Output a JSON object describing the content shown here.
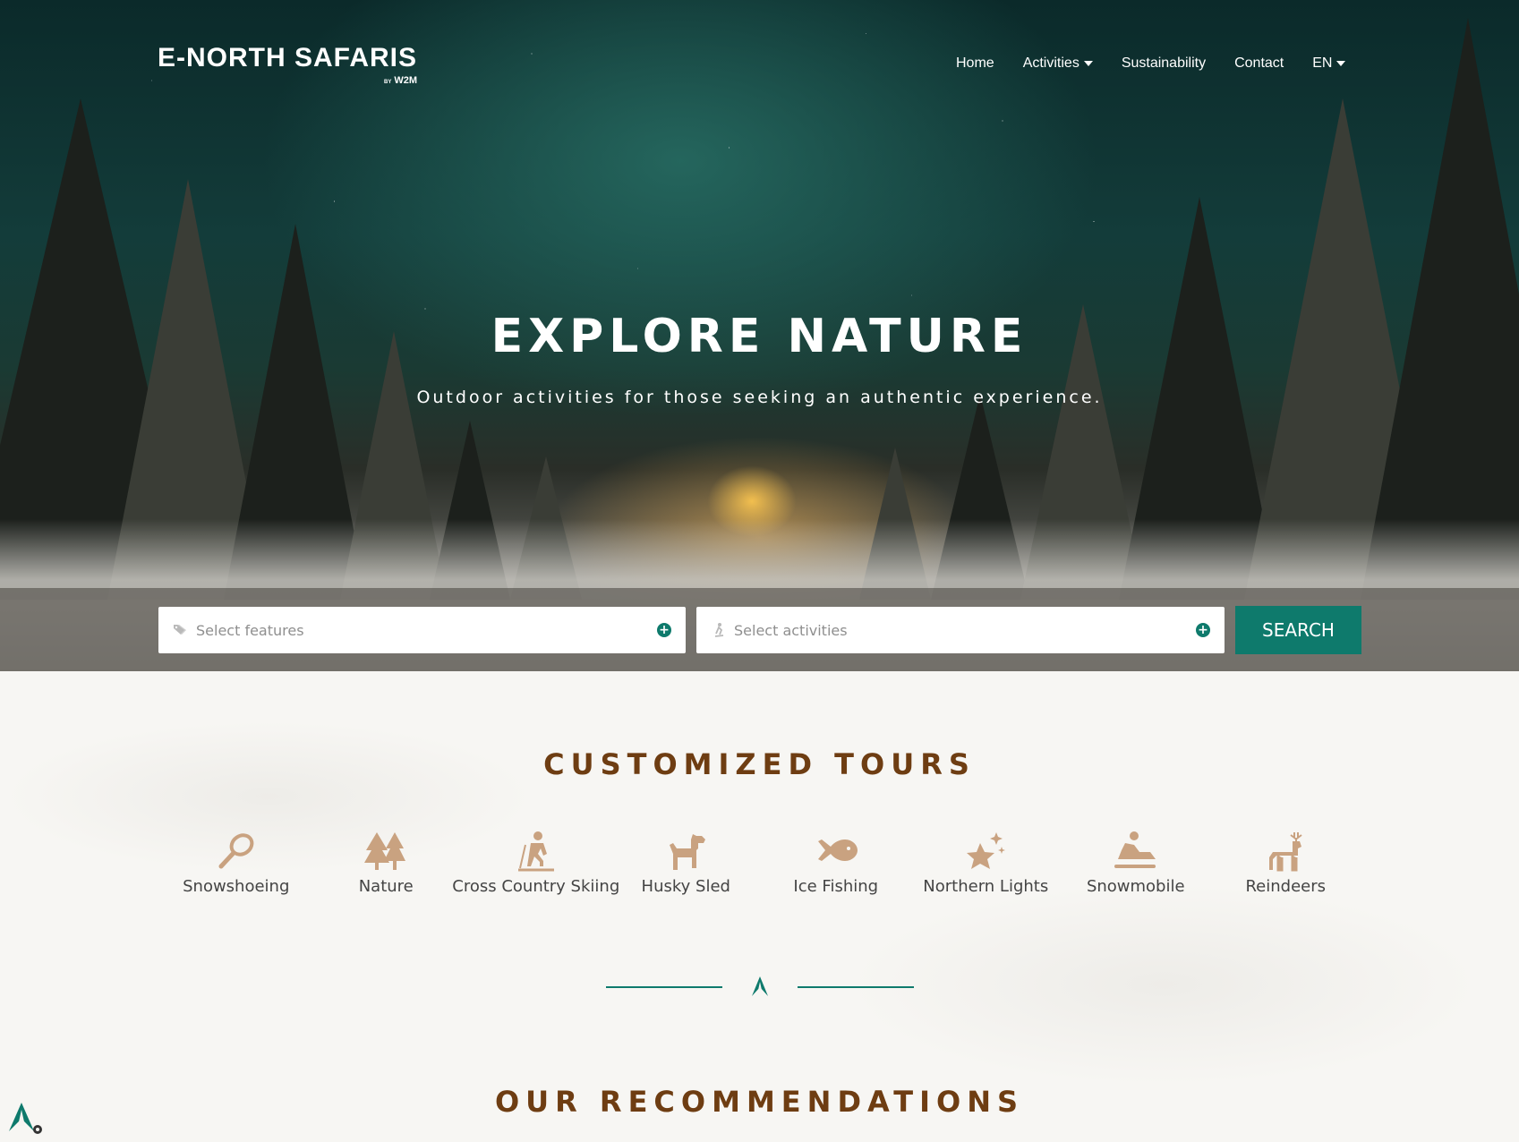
{
  "brand": {
    "name": "E-NORTH SAFARIS",
    "by": "BY",
    "sub": "W2M"
  },
  "nav": {
    "home": "Home",
    "activities": "Activities",
    "sustainability": "Sustainability",
    "contact": "Contact",
    "language": "EN"
  },
  "hero": {
    "title": "EXPLORE NATURE",
    "subtitle": "Outdoor activities for those seeking an authentic experience."
  },
  "search": {
    "features_placeholder": "Select features",
    "activities_placeholder": "Select activities",
    "button": "SEARCH"
  },
  "customized": {
    "title": "CUSTOMIZED TOURS",
    "items": [
      {
        "label": "Snowshoeing",
        "icon": "snowshoe-icon"
      },
      {
        "label": "Nature",
        "icon": "trees-icon"
      },
      {
        "label": "Cross Country Skiing",
        "icon": "skiing-icon"
      },
      {
        "label": "Husky Sled",
        "icon": "dog-icon"
      },
      {
        "label": "Ice Fishing",
        "icon": "fish-icon"
      },
      {
        "label": "Northern Lights",
        "icon": "stars-icon"
      },
      {
        "label": "Snowmobile",
        "icon": "snowmobile-icon"
      },
      {
        "label": "Reindeers",
        "icon": "reindeer-icon"
      }
    ]
  },
  "recommendations": {
    "title": "OUR RECOMMENDATIONS"
  },
  "colors": {
    "accent": "#0e7a6c",
    "heading": "#6e3d12",
    "icon": "#c9a280"
  }
}
